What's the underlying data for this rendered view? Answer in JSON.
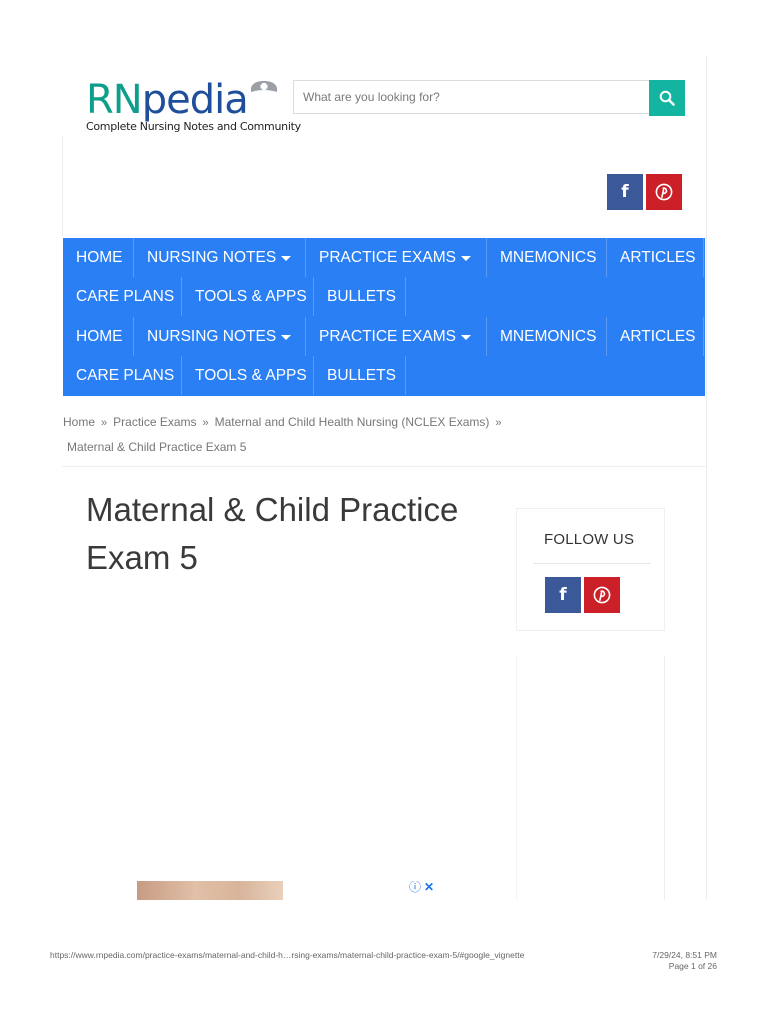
{
  "header": {
    "logo": {
      "rn": "RN",
      "pedia": "pedia",
      "tagline": "Complete Nursing Notes and Community"
    },
    "search": {
      "placeholder": "What are you looking for?",
      "value": "",
      "button_icon": "search-icon"
    },
    "social": [
      {
        "label": "f",
        "icon": "facebook-icon",
        "color": "#3b5898"
      },
      {
        "label": "",
        "icon": "pinterest-icon",
        "color": "#cb2027"
      }
    ]
  },
  "nav": {
    "color": "#2b7ff5",
    "menus": [
      {
        "row1": [
          {
            "label": "HOME",
            "dropdown": false
          },
          {
            "label": "NURSING NOTES",
            "dropdown": true
          },
          {
            "label": "PRACTICE EXAMS",
            "dropdown": true
          },
          {
            "label": "MNEMONICS",
            "dropdown": false
          },
          {
            "label": "ARTICLES",
            "dropdown": false
          }
        ],
        "row2": [
          {
            "label": "CARE PLANS",
            "dropdown": false
          },
          {
            "label": "TOOLS & APPS",
            "dropdown": false
          },
          {
            "label": "BULLETS",
            "dropdown": false
          }
        ]
      },
      {
        "row1": [
          {
            "label": "HOME",
            "dropdown": false
          },
          {
            "label": "NURSING NOTES",
            "dropdown": true
          },
          {
            "label": "PRACTICE EXAMS",
            "dropdown": true
          },
          {
            "label": "MNEMONICS",
            "dropdown": false
          },
          {
            "label": "ARTICLES",
            "dropdown": false
          }
        ],
        "row2": [
          {
            "label": "CARE PLANS",
            "dropdown": false
          },
          {
            "label": "TOOLS & APPS",
            "dropdown": false
          },
          {
            "label": "BULLETS",
            "dropdown": false
          }
        ]
      }
    ]
  },
  "breadcrumb": {
    "items": [
      "Home",
      "Practice Exams",
      "Maternal and Child Health Nursing (NCLEX Exams)"
    ],
    "separator": "»",
    "current": "Maternal & Child Practice Exam 5"
  },
  "article": {
    "title": "Maternal & Child Practice Exam 5"
  },
  "sidebar": {
    "follow_title": "FOLLOW US",
    "social": [
      {
        "label": "f",
        "icon": "facebook-icon",
        "color": "#3b5898"
      },
      {
        "label": "",
        "icon": "pinterest-icon",
        "color": "#cb2027"
      }
    ]
  },
  "ad": {
    "info_icon": "ⓘ",
    "close_icon": "✕"
  },
  "print_footer": {
    "url": "https://www.rnpedia.com/practice-exams/maternal-and-child-h…rsing-exams/maternal-child-practice-exam-5/#google_vignette",
    "datetime": "7/29/24, 8:51 PM",
    "page": "Page 1 of 26"
  }
}
